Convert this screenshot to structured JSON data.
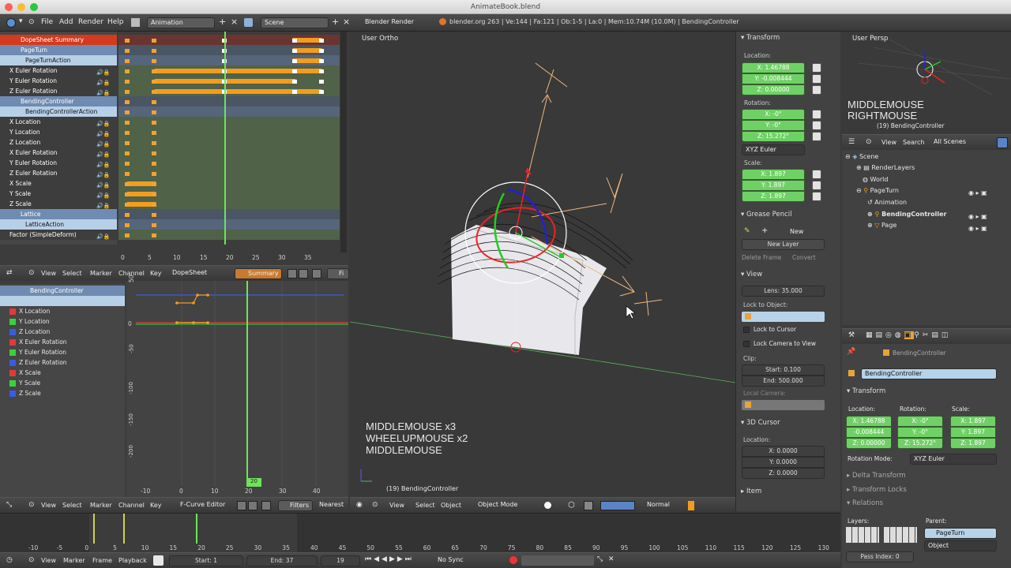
{
  "window": {
    "title": "AnimateBook.blend"
  },
  "topbar": {
    "menus": [
      "File",
      "Add",
      "Render",
      "Help"
    ],
    "screen": "Animation",
    "scene": "Scene",
    "engine": "Blender Render",
    "stats": "blender.org 263 | Ve:144 | Fa:121 | Ob:1-5 | La:0 | Mem:10.74M (10.0M) | BendingController"
  },
  "dopesheet": {
    "channels": [
      {
        "label": "DopeSheet Summary",
        "kind": "summary"
      },
      {
        "label": "PageTurn",
        "kind": "obj"
      },
      {
        "label": "PageTurnAction",
        "kind": "act"
      },
      {
        "label": "X Euler Rotation",
        "kind": "ch"
      },
      {
        "label": "Y Euler Rotation",
        "kind": "ch"
      },
      {
        "label": "Z Euler Rotation",
        "kind": "ch"
      },
      {
        "label": "BendingController",
        "kind": "obj"
      },
      {
        "label": "BendingControllerAction",
        "kind": "act"
      },
      {
        "label": "X Location",
        "kind": "ch"
      },
      {
        "label": "Y Location",
        "kind": "ch"
      },
      {
        "label": "Z Location",
        "kind": "ch"
      },
      {
        "label": "X Euler Rotation",
        "kind": "ch"
      },
      {
        "label": "Y Euler Rotation",
        "kind": "ch"
      },
      {
        "label": "Z Euler Rotation",
        "kind": "ch"
      },
      {
        "label": "X Scale",
        "kind": "ch"
      },
      {
        "label": "Y Scale",
        "kind": "ch"
      },
      {
        "label": "Z Scale",
        "kind": "ch"
      },
      {
        "label": "Lattice",
        "kind": "obj"
      },
      {
        "label": "LatticeAction",
        "kind": "act"
      },
      {
        "label": "Factor (SimpleDeform)",
        "kind": "ch"
      }
    ],
    "ticks": [
      "0",
      "5",
      "10",
      "15",
      "20",
      "25",
      "30",
      "35"
    ],
    "current_frame": "19",
    "header": {
      "menus": [
        "View",
        "Select",
        "Marker",
        "Channel",
        "Key"
      ],
      "mode": "DopeSheet",
      "summary": "Summary",
      "filter": "Fi"
    }
  },
  "graph": {
    "object": "BendingController",
    "channels": [
      {
        "label": "X Location",
        "color": "#e03a3a"
      },
      {
        "label": "Y Location",
        "color": "#3ad13a"
      },
      {
        "label": "Z Location",
        "color": "#3a5ce0"
      },
      {
        "label": "X Euler Rotation",
        "color": "#e03a3a"
      },
      {
        "label": "Y Euler Rotation",
        "color": "#3ad13a"
      },
      {
        "label": "Z Euler Rotation",
        "color": "#3a5ce0"
      },
      {
        "label": "X Scale",
        "color": "#e03a3a"
      },
      {
        "label": "Y Scale",
        "color": "#3ad13a"
      },
      {
        "label": "Z Scale",
        "color": "#3a5ce0"
      }
    ],
    "yticks": [
      "50",
      "0",
      "-50",
      "-100",
      "-150",
      "-200"
    ],
    "xticks": [
      "-10",
      "0",
      "10",
      "20",
      "30",
      "40"
    ],
    "current_frame": "20",
    "header": {
      "menus": [
        "View",
        "Select",
        "Marker",
        "Channel",
        "Key"
      ],
      "mode": "F-Curve Editor",
      "filters": "Filters",
      "nearest": "Nearest Fr"
    }
  },
  "viewport": {
    "label": "User Ortho",
    "keys": [
      "MIDDLEMOUSE x3",
      "WHEELUPMOUSE x2",
      "MIDDLEMOUSE"
    ],
    "object": "(19) BendingController",
    "header": {
      "menus": [
        "View",
        "Select",
        "Object"
      ],
      "mode": "Object Mode",
      "shading": "Normal"
    }
  },
  "npanel": {
    "transform": "Transform",
    "location_label": "Location:",
    "location": [
      "X: 1.46788",
      "Y: -0.008444",
      "Z: 0.00000"
    ],
    "rotation_label": "Rotation:",
    "rotation": [
      "X: -0°",
      "Y: -0°",
      "Z: 15.272°"
    ],
    "rot_mode": "XYZ Euler",
    "scale_label": "Scale:",
    "scale": [
      "X: 1.897",
      "Y: 1.897",
      "Z: 1.897"
    ],
    "grease": "Grease Pencil",
    "new": "New",
    "new_layer": "New Layer",
    "delete_frame": "Delete Frame",
    "convert": "Convert",
    "view": "View",
    "lens": "Lens: 35.000",
    "lock_obj": "Lock to Object:",
    "lock_cursor": "Lock to Cursor",
    "lock_camera": "Lock Camera to View",
    "clip": "Clip:",
    "clip_start": "Start: 0.100",
    "clip_end": "End: 500.000",
    "local_camera": "Local Camera:",
    "cursor": "3D Cursor",
    "cursor_loc": "Location:",
    "cursor_vals": [
      "X: 0.0000",
      "Y: 0.0000",
      "Z: 0.0000"
    ],
    "item": "Item"
  },
  "persp": {
    "label": "User Persp",
    "keys": [
      "MIDDLEMOUSE",
      "RIGHTMOUSE"
    ],
    "object": "(19) BendingController"
  },
  "outliner": {
    "header": {
      "view": "View",
      "search": "Search",
      "filter": "All Scenes"
    },
    "items": [
      {
        "label": "Scene",
        "indent": 0
      },
      {
        "label": "RenderLayers",
        "indent": 1
      },
      {
        "label": "World",
        "indent": 1
      },
      {
        "label": "PageTurn",
        "indent": 1
      },
      {
        "label": "Animation",
        "indent": 2
      },
      {
        "label": "BendingController",
        "indent": 2
      },
      {
        "label": "Page",
        "indent": 2
      }
    ]
  },
  "props": {
    "crumb": "BendingController",
    "name": "BendingController",
    "transform": "Transform",
    "loc_label": "Location:",
    "rot_label": "Rotation:",
    "scale_label": "Scale:",
    "loc": [
      "X: 1.46788",
      "-0.008444",
      "Z: 0.00000"
    ],
    "rot": [
      "X: -0°",
      "Y: -0°",
      "Z: 15.272°"
    ],
    "scale": [
      "X: 1.897",
      "Y: 1.897",
      "Z: 1.897"
    ],
    "rot_mode_label": "Rotation Mode:",
    "rot_mode": "XYZ Euler",
    "delta": "Delta Transform",
    "locks": "Transform Locks",
    "relations": "Relations",
    "layers": "Layers:",
    "parent": "Parent:",
    "parent_val": "PageTurn",
    "parent_type": "Object",
    "pass_index": "Pass Index: 0"
  },
  "timeline": {
    "ticks": [
      "-10",
      "-5",
      "0",
      "5",
      "10",
      "15",
      "20",
      "25",
      "30",
      "35",
      "40",
      "45",
      "50",
      "55",
      "60",
      "65",
      "70",
      "75",
      "80",
      "85",
      "90",
      "95",
      "100",
      "105",
      "110",
      "115",
      "120",
      "125",
      "130"
    ],
    "menus": [
      "View",
      "Marker",
      "Frame",
      "Playback"
    ],
    "start": "Start: 1",
    "end": "End: 37",
    "frame": "19",
    "sync": "No Sync"
  }
}
